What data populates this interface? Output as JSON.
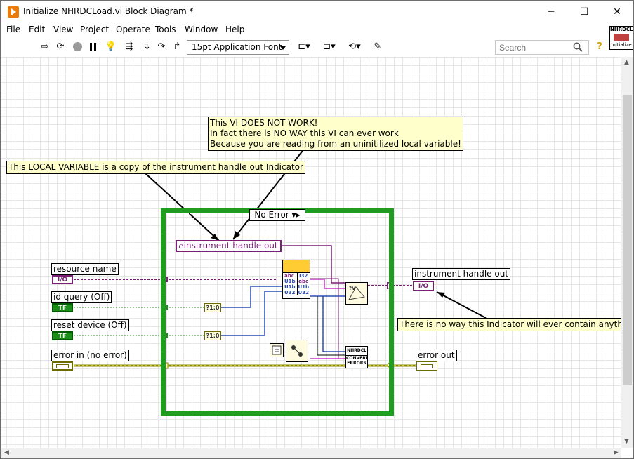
{
  "window": {
    "title": "Initialize NHRDCLoad.vi Block Diagram *",
    "controls": {
      "minimize": "─",
      "maximize": "☐",
      "close": "✕"
    }
  },
  "menu": [
    "File",
    "Edit",
    "View",
    "Project",
    "Operate",
    "Tools",
    "Window",
    "Help"
  ],
  "toolbar": {
    "font": "15pt Application Font",
    "search_placeholder": "Search"
  },
  "vi_icon_text": [
    "NHRDCL",
    "Initialize"
  ],
  "diagram": {
    "case_selector": "No Error",
    "local_variable": "instrument handle out",
    "controls": [
      {
        "label": "resource name",
        "type": "io",
        "glyph": "I/O"
      },
      {
        "label": "id query (Off)",
        "type": "tf",
        "glyph": "TF"
      },
      {
        "label": "reset device (Off)",
        "type": "tf",
        "glyph": "TF"
      },
      {
        "label": "error in (no error)",
        "type": "err",
        "glyph": ""
      }
    ],
    "indicators": [
      {
        "label": "instrument handle out",
        "glyph": "I/O"
      },
      {
        "label": "error out",
        "glyph": ""
      }
    ],
    "select_glyph": "?1:0",
    "error_node": [
      "NHRDCL",
      "CONVERT",
      "ERRORS"
    ],
    "node_pins": [
      "abc",
      "U1b",
      "U1b",
      "U32",
      "I32"
    ]
  },
  "notes": {
    "top": [
      "This VI DOES NOT WORK!",
      "In fact there is NO WAY this VI can ever work",
      "Because you are reading from an uninitilized local variable!"
    ],
    "local": "This LOCAL VARIABLE is a copy of the instrument handle out Indicator",
    "indicator": "There is no way this Indicator will ever contain anything"
  },
  "colors": {
    "refnum": "#7a1f75",
    "boolean": "#1a8f1a",
    "numeric": "#2a4bb5",
    "error": "#8a8a00",
    "note_bg": "#ffffcc",
    "case_border": "#1e9d1e"
  }
}
